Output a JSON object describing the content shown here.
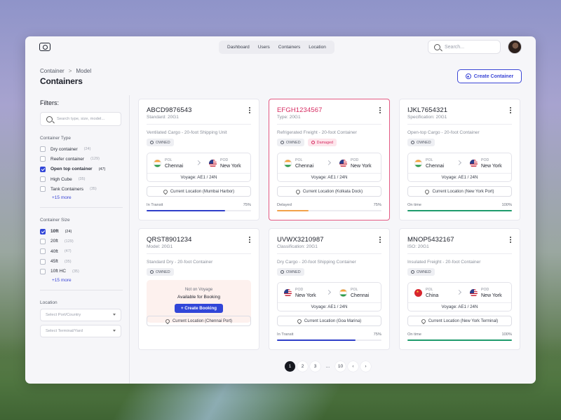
{
  "nav": {
    "items": [
      "Dashboard",
      "Users",
      "Containers",
      "Location"
    ]
  },
  "search": {
    "placeholder": "Search..."
  },
  "breadcrumb": {
    "parent": "Container",
    "separator": ">",
    "current": "Model"
  },
  "page_title": "Containers",
  "create_button": "Create Container",
  "sidebar": {
    "filters_title": "Filters:",
    "search_placeholder": "Search type, size, model...",
    "type_title": "Container Type",
    "types": [
      {
        "label": "Dry container",
        "count": "(24)",
        "checked": false
      },
      {
        "label": "Reefer container",
        "count": "(129)",
        "checked": false
      },
      {
        "label": "Open top container",
        "count": "(47)",
        "checked": true
      },
      {
        "label": "High Cube",
        "count": "(35)",
        "checked": false
      },
      {
        "label": "Tank Containers",
        "count": "(35)",
        "checked": false
      }
    ],
    "types_more": "+15 more",
    "size_title": "Container Size",
    "sizes": [
      {
        "label": "10ft",
        "count": "(24)",
        "checked": true
      },
      {
        "label": "20ft",
        "count": "(129)",
        "checked": false
      },
      {
        "label": "40ft",
        "count": "(47)",
        "checked": false
      },
      {
        "label": "45ft",
        "count": "(35)",
        "checked": false
      },
      {
        "label": "10ft HC",
        "count": "(35)",
        "checked": false
      }
    ],
    "sizes_more": "+15 more",
    "location_title": "Location",
    "port_placeholder": "Select Port/Country",
    "terminal_placeholder": "Select Terminal/Yard"
  },
  "cards": [
    {
      "id": "ABCD9876543",
      "sub": "Standard: 20G1",
      "desc": "Ventilated Cargo - 20-foot Shipping Unit",
      "owned": "OWNED",
      "damaged": "",
      "pol_label": "POL",
      "pol": "Chennai",
      "pol_flag": "in",
      "pod_label": "POD",
      "pod": "New York",
      "pod_flag": "us",
      "voyage": "Voyage:  AE1 / 24N",
      "location": "Current Location (Mumbai Harbor)",
      "status": "In Transit",
      "percent_label": "75%",
      "progress": 0.75,
      "color": "#2f3fc9"
    },
    {
      "id": "EFGH1234567",
      "sub": "Type: 20G1",
      "desc": "Refrigerated Freight - 20-foot Container",
      "owned": "OWNED",
      "damaged": "Damaged",
      "pol_label": "POL",
      "pol": "Chennai",
      "pol_flag": "in",
      "pod_label": "POD",
      "pod": "New York",
      "pod_flag": "us",
      "voyage": "Voyage:  AE1 / 24N",
      "location": "Current Location (Kolkata Dock)",
      "status": "Delayed",
      "percent_label": "75%",
      "progress": 0.3,
      "color": "#f2a24a"
    },
    {
      "id": "IJKL7654321",
      "sub": "Specification: 20G1",
      "desc": "Open-top Cargo - 20-foot Container",
      "owned": "OWNED",
      "damaged": "",
      "pol_label": "POL",
      "pol": "Chennai",
      "pol_flag": "in",
      "pod_label": "POD",
      "pod": "New York",
      "pod_flag": "us",
      "voyage": "Voyage:  AE1 / 24N",
      "location": "Current Location (New York Port)",
      "status": "On time",
      "percent_label": "100%",
      "progress": 1.0,
      "color": "#1e9b6c"
    },
    {
      "id": "QRST8901234",
      "sub": "Model: 20G1",
      "desc": "Standard Dry - 20-foot Container",
      "owned": "OWNED",
      "damaged": "",
      "not_on_voyage": "Not on Voyage",
      "available": "Available for Booking",
      "booking_button": "+ Create Booking",
      "location": "Current Location (Chennai Port)"
    },
    {
      "id": "UVWX3210987",
      "sub": "Classification: 20G1",
      "desc": "Dry Cargo - 20-foot Shipping Container",
      "owned": "OWNED",
      "damaged": "",
      "pol_label": "POD",
      "pol": "New York",
      "pol_flag": "us",
      "pod_label": "POL",
      "pod": "Chennai",
      "pod_flag": "in",
      "voyage": "Voyage:  AE1 / 24N",
      "location": "Current Location (Goa Marina)",
      "status": "In Transit",
      "percent_label": "75%",
      "progress": 0.75,
      "color": "#2f3fc9"
    },
    {
      "id": "MNOP5432167",
      "sub": "ISO: 20G1",
      "desc": "Insulated Freight - 20-foot Container",
      "owned": "OWNED",
      "damaged": "",
      "pol_label": "POL",
      "pol": "China",
      "pol_flag": "cn",
      "pod_label": "POD",
      "pod": "New York",
      "pod_flag": "us",
      "voyage": "Voyage:  AE1 / 24N",
      "location": "Current Location (New York Terminal)",
      "status": "On time",
      "percent_label": "100%",
      "progress": 1.0,
      "color": "#1e9b6c"
    }
  ],
  "pagination": {
    "pages": [
      "1",
      "2",
      "3",
      "...",
      "10"
    ],
    "current": "1",
    "prev": "‹",
    "next": "›"
  }
}
